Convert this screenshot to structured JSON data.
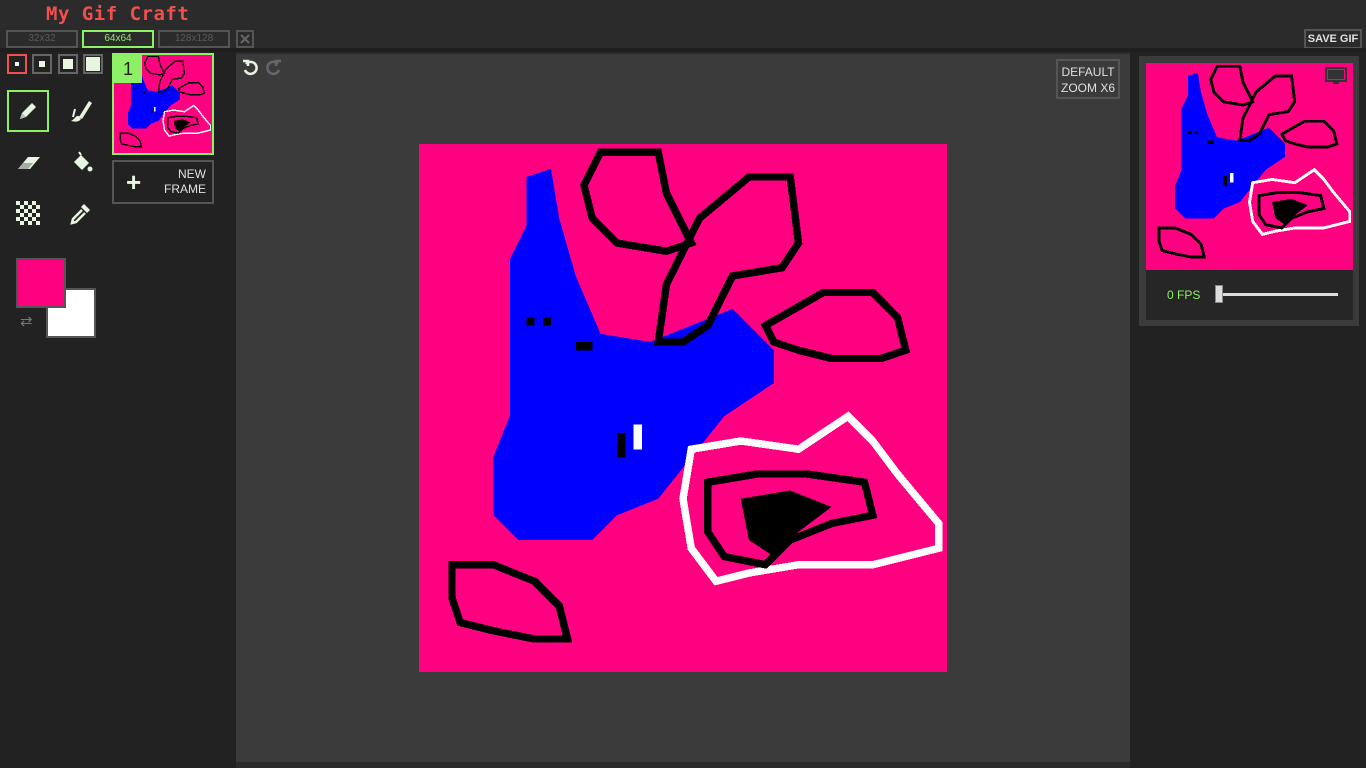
{
  "app": {
    "title": "My Gif Craft"
  },
  "header": {
    "sizes": [
      {
        "label": "32x32",
        "active": false
      },
      {
        "label": "64x64",
        "active": true
      },
      {
        "label": "128x128",
        "active": false
      }
    ],
    "save_label": "SAVE GIF"
  },
  "tools": {
    "brush_sizes": [
      "size-1",
      "size-2",
      "size-3",
      "size-4"
    ],
    "items": [
      "pencil-icon",
      "brush-icon",
      "eraser-icon",
      "fill-bucket-icon",
      "checker-icon",
      "eyedropper-icon"
    ],
    "primary_color": "#ff0080",
    "secondary_color": "#ffffff"
  },
  "frames": {
    "items": [
      {
        "number": "1",
        "selected": true
      }
    ],
    "new_frame_label_1": "NEW",
    "new_frame_label_2": "FRAME"
  },
  "canvas": {
    "zoom_label_1": "DEFAULT",
    "zoom_label_2": "ZOOM X6",
    "background_color": "#ff0080"
  },
  "preview": {
    "fps_label": "0 FPS",
    "fps_value": 0
  },
  "colors": {
    "accent": "#8df065",
    "title": "#f0504e",
    "canvas_pink": "#ff0080",
    "paint_blue": "#0000ff",
    "outline_black": "#000000",
    "outline_white": "#ffffff"
  }
}
